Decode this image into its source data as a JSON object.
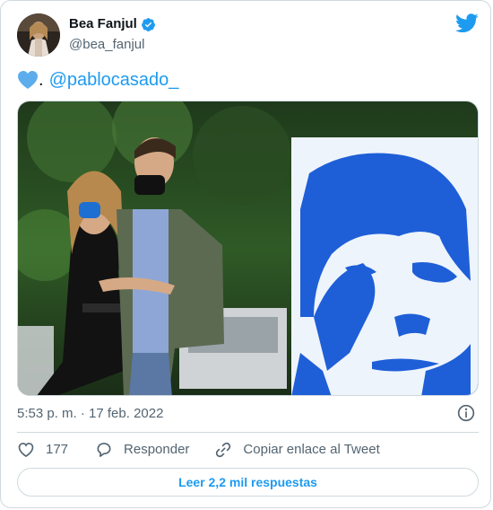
{
  "author": {
    "display_name": "Bea Fanjul",
    "handle": "@bea_fanjul",
    "verified_icon": "verified-badge-icon",
    "avatar_icon": "avatar"
  },
  "brand": {
    "icon": "twitter-bird-icon",
    "color": "#1d9bf0"
  },
  "tweet": {
    "emoji_icon": "blue-heart-icon",
    "separator": ".",
    "mention": "@pablocasado_"
  },
  "media": {
    "kind": "photo"
  },
  "meta": {
    "timestamp": "5:53 p. m. · 17 feb. 2022",
    "info_icon": "info-icon"
  },
  "actions": {
    "like_count": "177",
    "reply_label": "Responder",
    "copy_label": "Copiar enlace al Tweet"
  },
  "read_replies_label": "Leer 2,2 mil respuestas",
  "colors": {
    "accent": "#1d9bf0",
    "muted": "#536471",
    "border": "#cfd9de",
    "text": "#0f1419"
  }
}
